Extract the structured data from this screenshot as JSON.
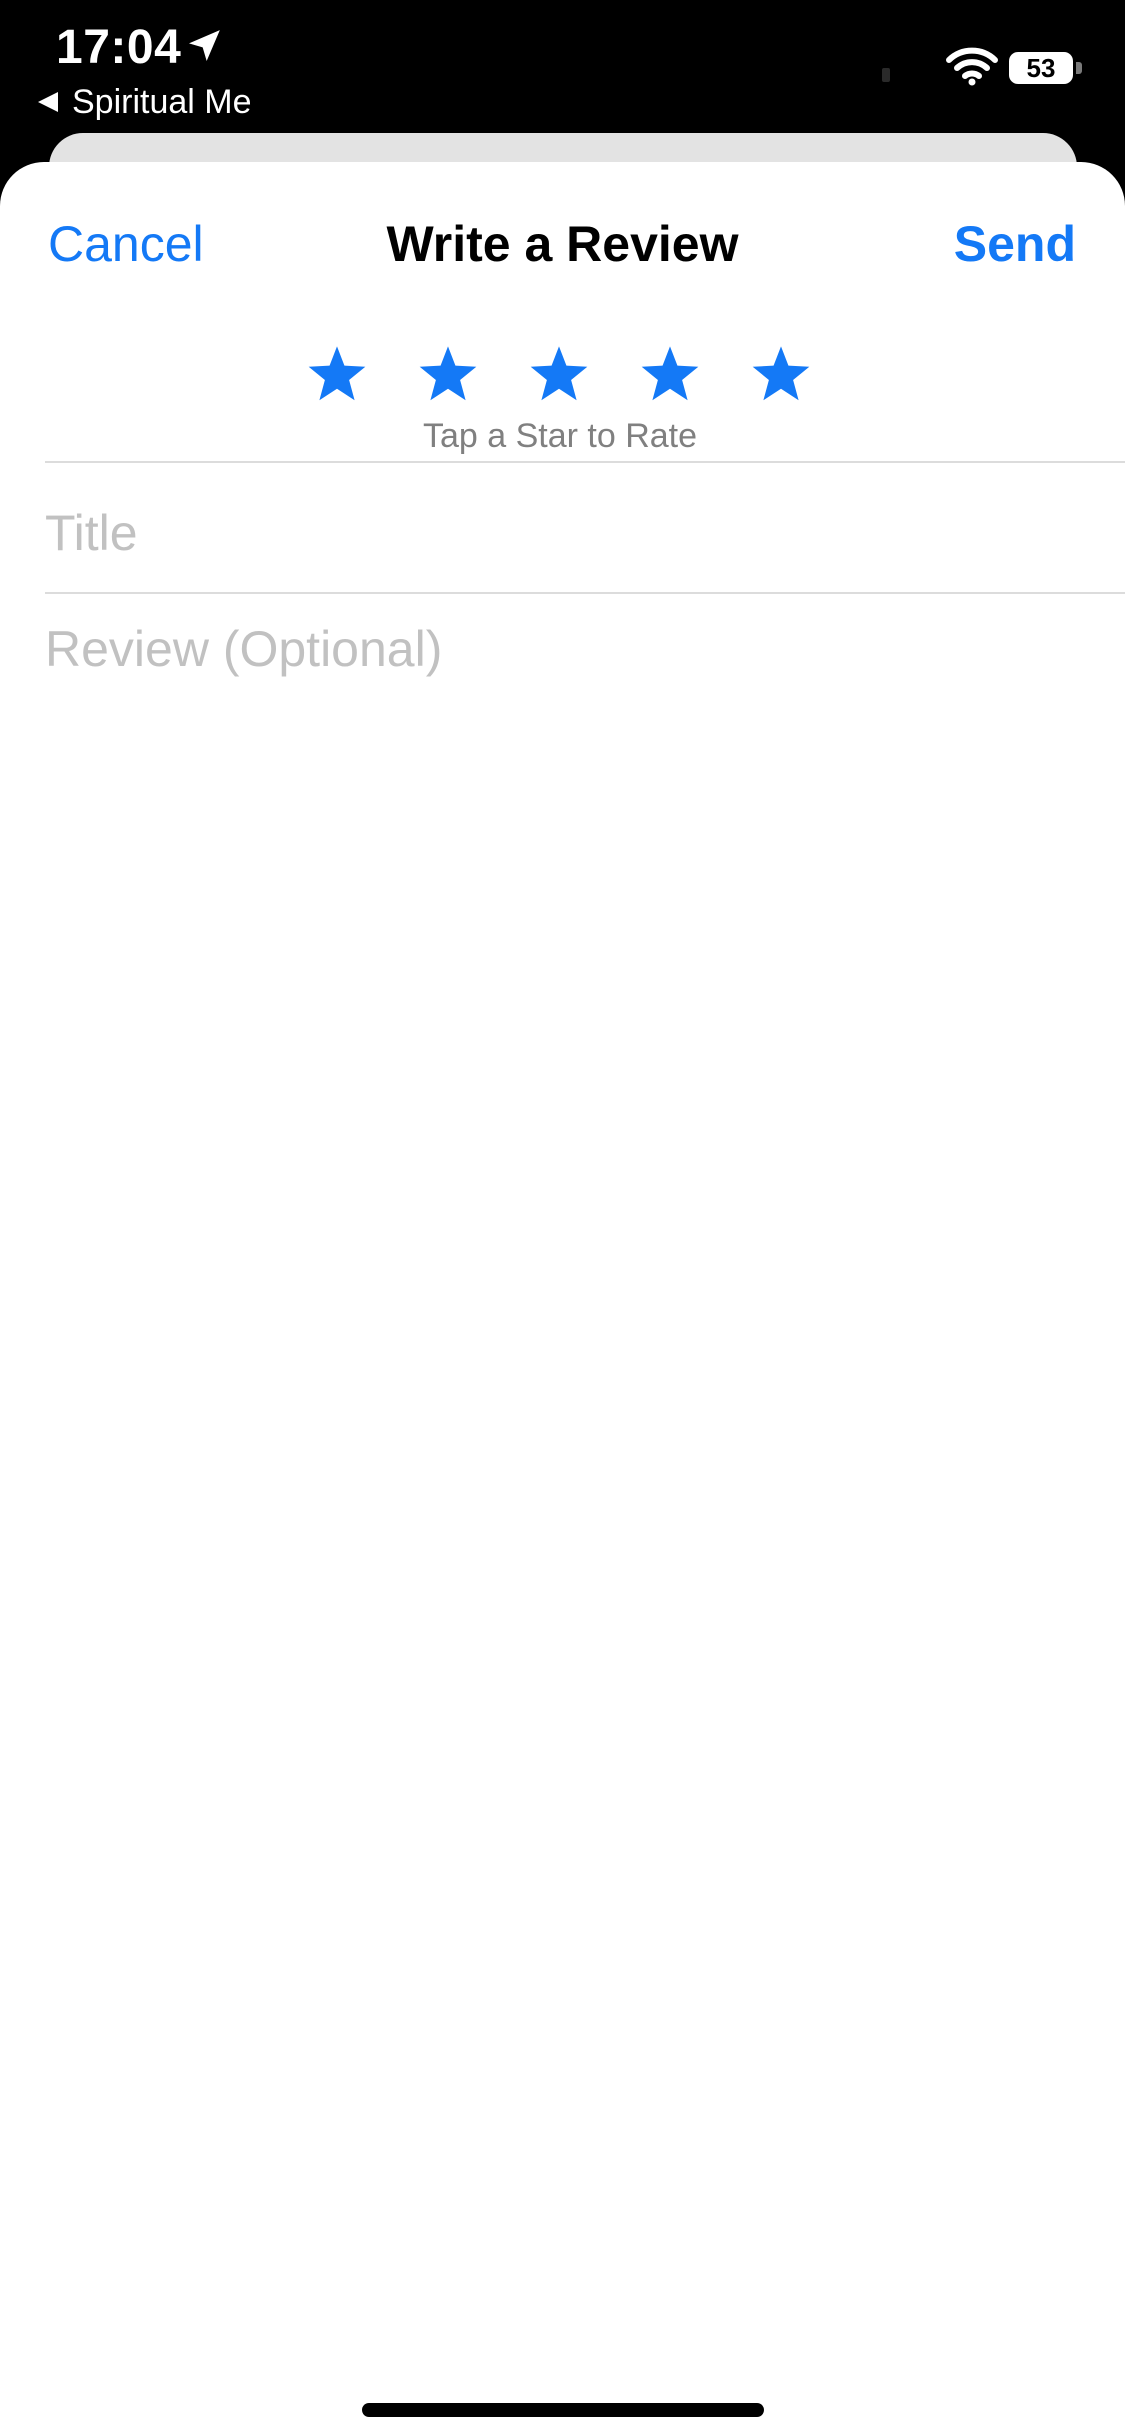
{
  "status_bar": {
    "time": "17:04",
    "location_icon": "location-arrow-icon",
    "back_app_label": "Spiritual Me",
    "wifi_icon": "wifi-icon",
    "battery_level": "53"
  },
  "nav": {
    "cancel_label": "Cancel",
    "title": "Write a Review",
    "send_label": "Send"
  },
  "rating": {
    "star_count": 5,
    "selected": 0,
    "star_icon": "star-icon",
    "star_color": "#1479f6",
    "hint": "Tap a Star to Rate"
  },
  "form": {
    "title_placeholder": "Title",
    "title_value": "",
    "review_placeholder": "Review (Optional)",
    "review_value": ""
  },
  "colors": {
    "accent": "#1479f6",
    "placeholder": "#c1c1c1",
    "hint": "#808080",
    "divider": "#dcdcdc"
  }
}
